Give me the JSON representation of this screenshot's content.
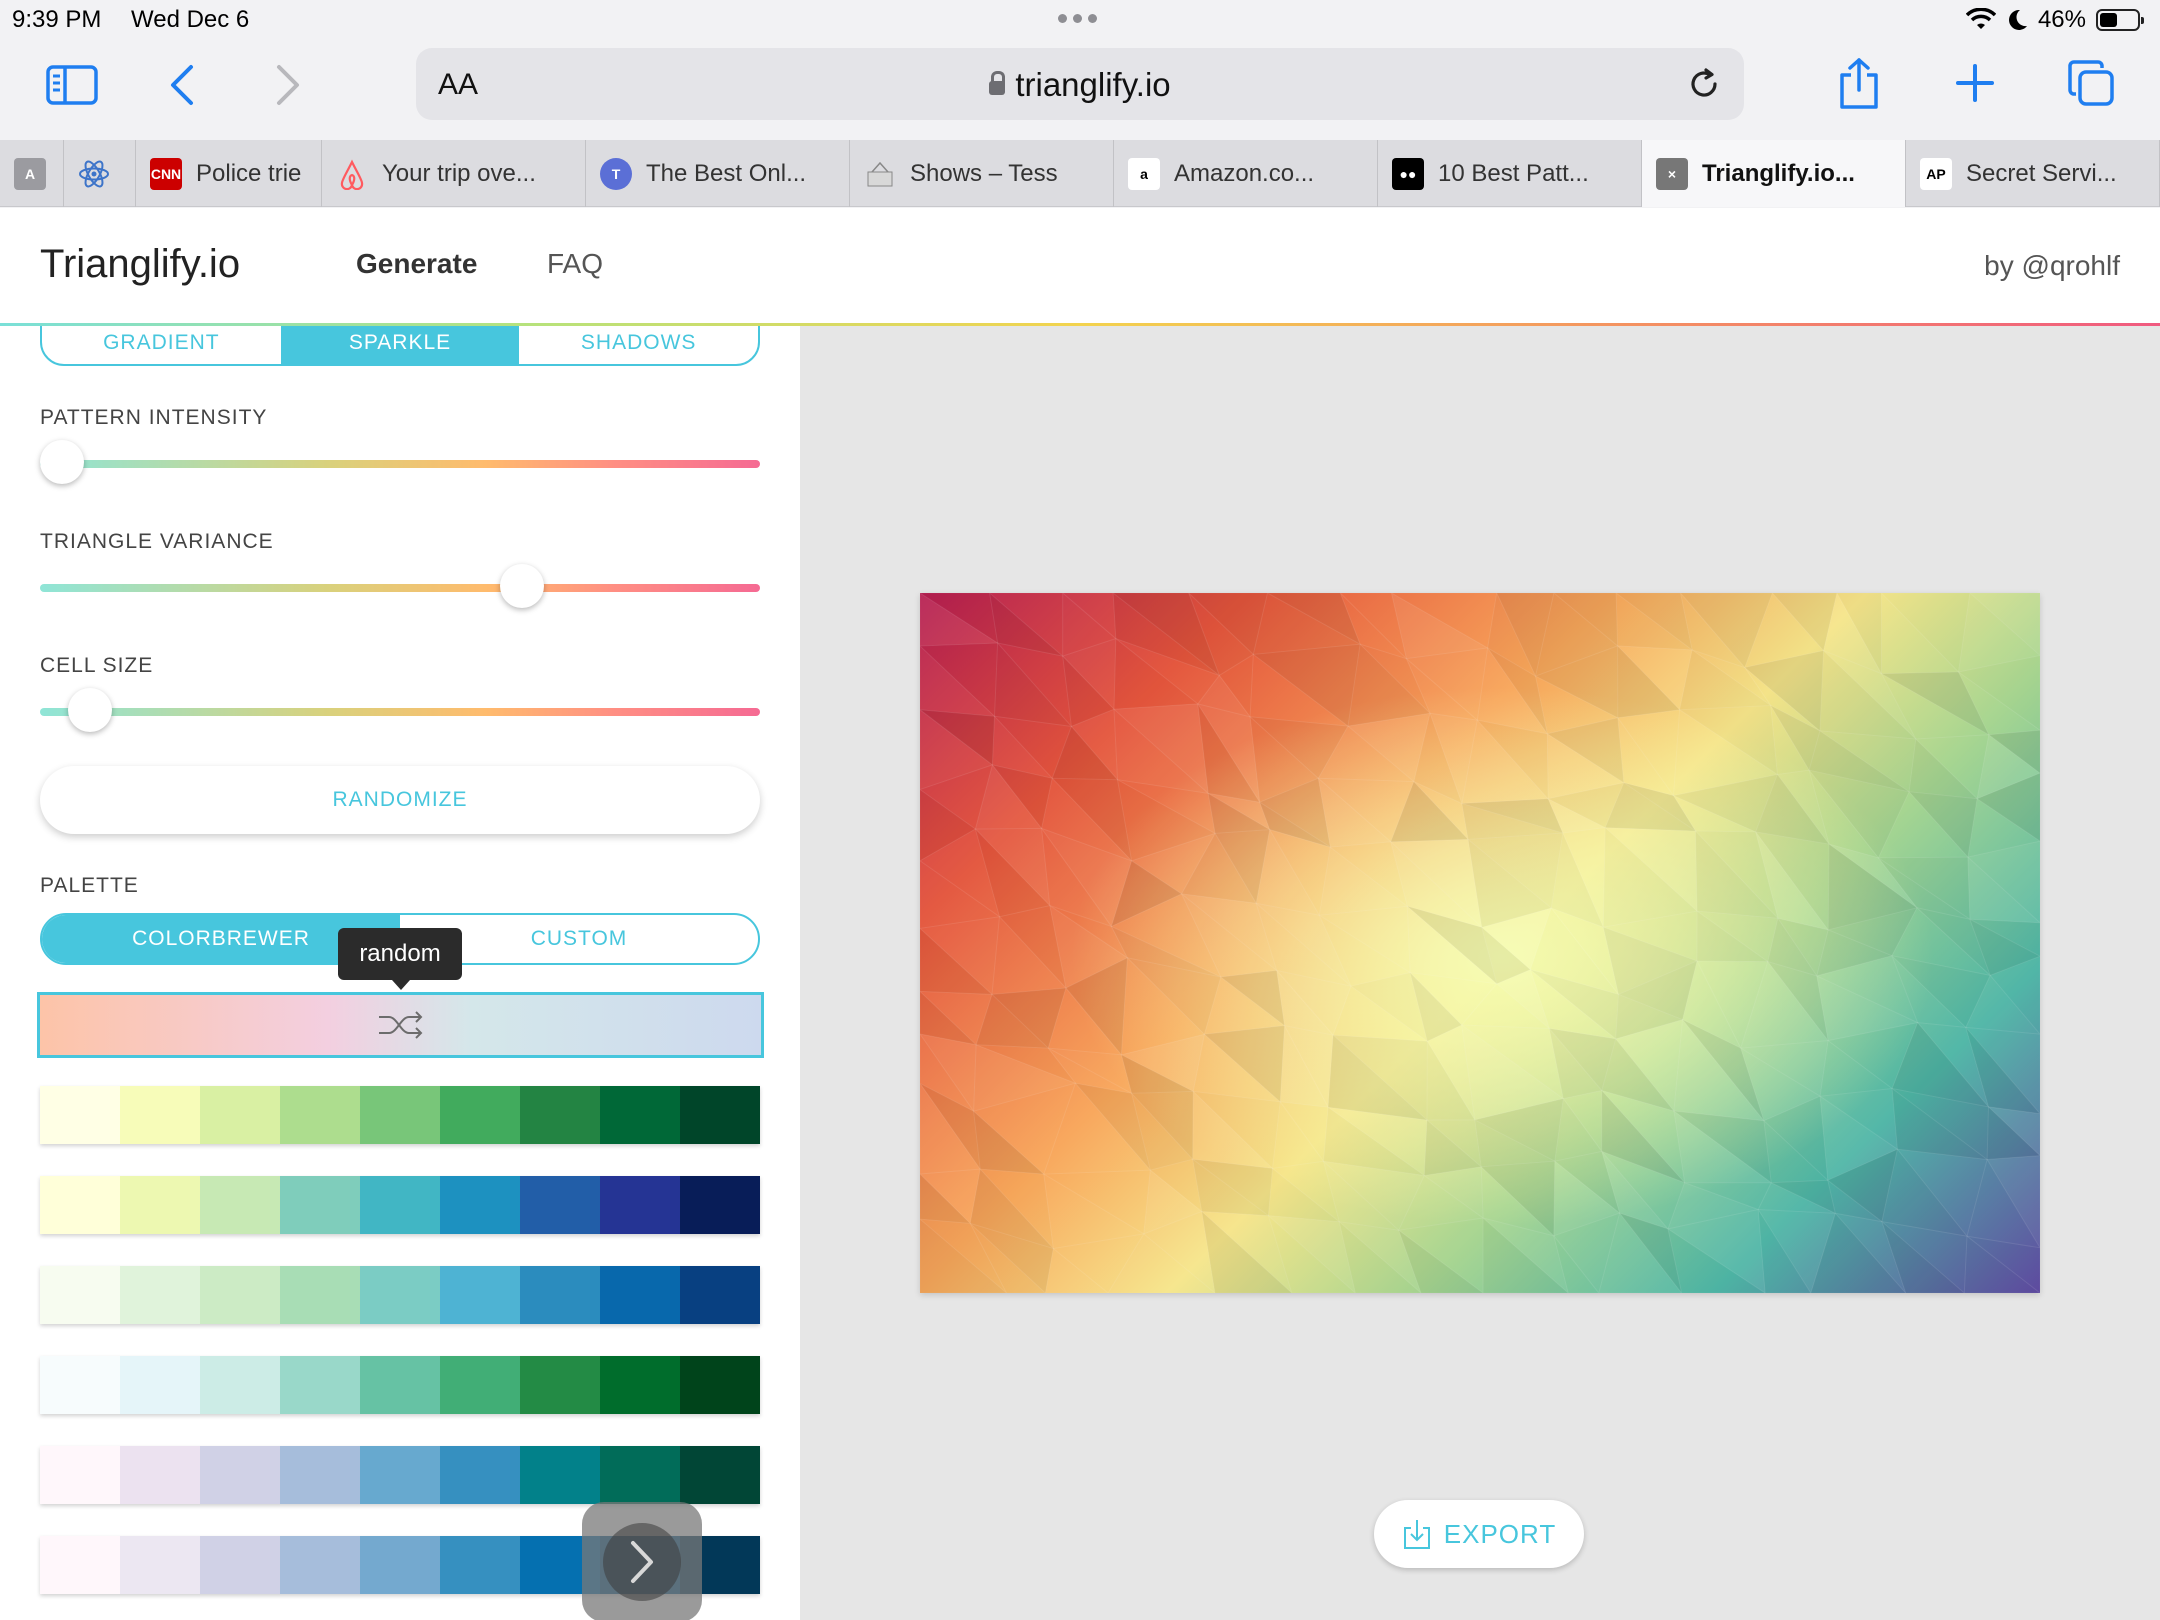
{
  "status_bar": {
    "time": "9:39 PM",
    "date": "Wed Dec 6",
    "battery": "46%",
    "battery_level": 0.46
  },
  "browser": {
    "text_size_label": "AA",
    "url": "trianglify.io",
    "tabs": [
      {
        "label": "",
        "favicon": "letter-a-icon",
        "favicon_text": "A",
        "favicon_bg": "#9b9ba0"
      },
      {
        "label": "",
        "favicon": "react-atom-icon",
        "favicon_text": "",
        "favicon_bg": "transparent"
      },
      {
        "label": "Police trie",
        "favicon": "cnn-logo",
        "favicon_text": "CNN",
        "favicon_bg": "#cc0000"
      },
      {
        "label": "Your trip ove...",
        "favicon": "airbnb-icon",
        "favicon_text": "",
        "favicon_bg": "transparent"
      },
      {
        "label": "The Best Onl...",
        "favicon": "nyt-icon",
        "favicon_text": "T",
        "favicon_bg": "#5b6fd6"
      },
      {
        "label": "Shows – Tess",
        "favicon": "shows-icon",
        "favicon_text": "",
        "favicon_bg": "transparent"
      },
      {
        "label": "Amazon.co...",
        "favicon": "amazon-icon",
        "favicon_text": "a",
        "favicon_bg": "#ffffff"
      },
      {
        "label": "10 Best Patt...",
        "favicon": "medium-icon",
        "favicon_text": "●●",
        "favicon_bg": "#000000"
      },
      {
        "label": "Trianglify.io...",
        "favicon": "close-tab-icon",
        "favicon_text": "×",
        "favicon_bg": "#777777",
        "active": true
      },
      {
        "label": "Secret Servi...",
        "favicon": "ap-icon",
        "favicon_text": "AP",
        "favicon_bg": "#ffffff"
      }
    ]
  },
  "site": {
    "brand": "Trianglify.io",
    "nav": {
      "generate": "Generate",
      "faq": "FAQ"
    },
    "by": "by @qrohlf"
  },
  "sidebar": {
    "mode_tabs": [
      "GRADIENT",
      "SPARKLE",
      "SHADOWS"
    ],
    "mode_active": 1,
    "sliders": [
      {
        "label": "PATTERN INTENSITY",
        "value": 0.03
      },
      {
        "label": "TRIANGLE VARIANCE",
        "value": 0.67
      },
      {
        "label": "CELL SIZE",
        "value": 0.07
      }
    ],
    "randomize_label": "RANDOMIZE",
    "palette_label": "PALETTE",
    "palette_tabs": [
      "COLORBREWER",
      "CUSTOM"
    ],
    "palette_active": 0,
    "tooltip": "random",
    "palettes": [
      [
        "#ffffe5",
        "#f7fcb9",
        "#d9f0a3",
        "#addd8e",
        "#78c679",
        "#41ab5d",
        "#238443",
        "#006837",
        "#004529"
      ],
      [
        "#ffffd9",
        "#edf8b1",
        "#c7e9b4",
        "#7fcdbb",
        "#41b6c4",
        "#1d91c0",
        "#225ea8",
        "#253494",
        "#081d58"
      ],
      [
        "#f7fcf0",
        "#e0f3db",
        "#ccebc5",
        "#a8ddb5",
        "#7bccc4",
        "#4eb3d3",
        "#2b8cbe",
        "#0868ac",
        "#084081"
      ],
      [
        "#f7fcfd",
        "#e5f5f9",
        "#ccece6",
        "#99d8c9",
        "#66c2a4",
        "#41ae76",
        "#238b45",
        "#006d2c",
        "#00441b"
      ],
      [
        "#fff7fb",
        "#ece2f0",
        "#d0d1e6",
        "#a6bddb",
        "#67a9cf",
        "#3690c0",
        "#02818a",
        "#016c59",
        "#014636"
      ],
      [
        "#fff7fb",
        "#ece7f2",
        "#d0d1e6",
        "#a6bddb",
        "#74a9cf",
        "#3690c0",
        "#0570b0",
        "#045a8d",
        "#023858"
      ]
    ]
  },
  "main": {
    "export_label": "EXPORT"
  }
}
